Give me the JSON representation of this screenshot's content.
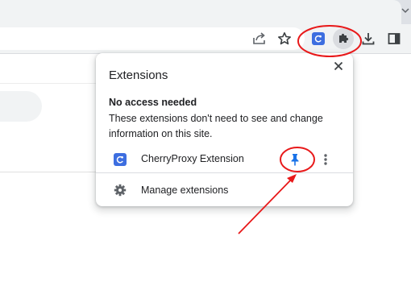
{
  "popup": {
    "title": "Extensions",
    "close_icon": "close-icon",
    "section_heading": "No access needed",
    "section_description": "These extensions don't need to see and change information on this site.",
    "extensions": [
      {
        "name": "CherryProxy Extension",
        "icon": "cherryproxy-icon",
        "pinned": true,
        "pin_icon": "pin-icon",
        "more_icon": "more-vert-icon"
      }
    ],
    "manage_label": "Manage extensions",
    "manage_icon": "gear-icon"
  },
  "toolbar": {
    "icons": [
      "share-icon",
      "bookmark-star-icon",
      "cherryproxy-icon",
      "puzzle-icon",
      "download-icon",
      "side-panel-icon"
    ]
  },
  "colors": {
    "annotation_red": "#e8191a",
    "pin_blue": "#1a73e8",
    "extension_icon_blue": "#3d6ee0",
    "toolbar_bg": "#f1f3f4"
  }
}
